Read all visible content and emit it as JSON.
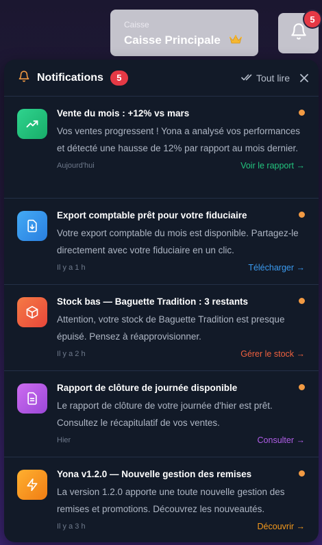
{
  "caisse": {
    "label": "Caisse",
    "name": "Caisse Principale"
  },
  "bell_badge": "5",
  "panel": {
    "title": "Notifications",
    "count": "5",
    "mark_all": "Tout lire",
    "icons": {
      "title": "bell-icon",
      "mark_all": "double-check-icon",
      "close": "close-icon"
    }
  },
  "notifications": [
    {
      "title": "Vente du mois : +12% vs mars",
      "body": "Vos ventes progressent ! Yona a analysé vos performances et détecté une hausse de 12% par rapport au mois dernier.",
      "time": "Aujourd'hui",
      "action": "Voir le rapport →",
      "icon": "trending-up-icon",
      "color": "#23c47e"
    },
    {
      "title": "Export comptable prêt pour votre fiduciaire",
      "body": "Votre export comptable du mois est disponible. Partagez-le directement avec votre fiduciaire en un clic.",
      "time": "Il y a 1 h",
      "action": "Télécharger →",
      "icon": "download-file-icon",
      "color": "#3b9bf0"
    },
    {
      "title": "Stock bas — Baguette Tradition : 3 restants",
      "body": "Attention, votre stock de Baguette Tradition est presque épuisé. Pensez à réapprovisionner.",
      "time": "Il y a 2 h",
      "action": "Gérer le stock →",
      "icon": "box-icon",
      "color": "#f0613f"
    },
    {
      "title": "Rapport de clôture de journée disponible",
      "body": "Le rapport de clôture de votre journée d'hier est prêt. Consultez le récapitulatif de vos ventes.",
      "time": "Hier",
      "action": "Consulter →",
      "icon": "document-icon",
      "color": "#b15ee8"
    },
    {
      "title": "Yona v1.2.0 — Nouvelle gestion des remises",
      "body": "La version 1.2.0 apporte une toute nouvelle gestion des remises et promotions. Découvrez les nouveautés.",
      "time": "Il y a 3 h",
      "action": "Découvrir →",
      "icon": "lightning-icon",
      "color": "#f59a1c"
    }
  ],
  "colors": {
    "unread_dot": "#f29a43",
    "badge": "#e53945",
    "panel_bg": "#121a28"
  }
}
